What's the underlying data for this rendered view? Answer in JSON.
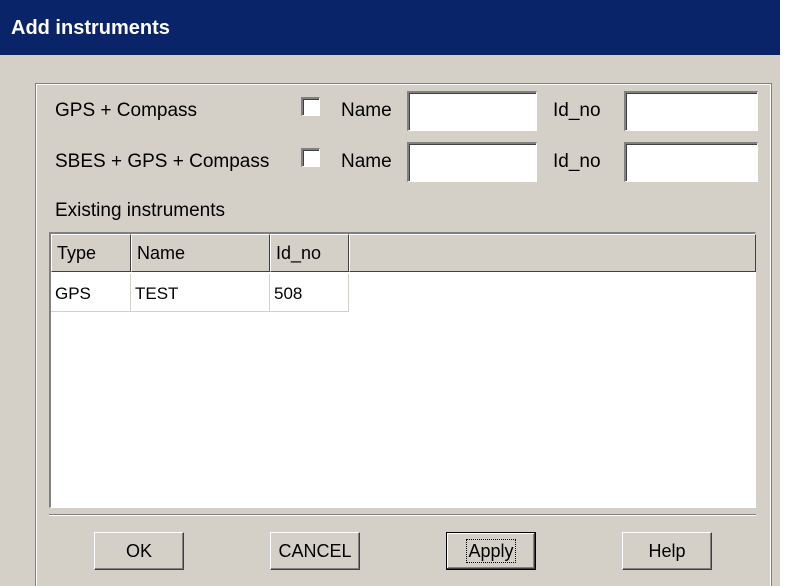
{
  "window": {
    "title": "Add instruments"
  },
  "instruments": [
    {
      "label": "GPS + Compass",
      "checked": false,
      "name_label": "Name",
      "name_value": "",
      "id_label": "Id_no",
      "id_value": ""
    },
    {
      "label": "SBES + GPS + Compass",
      "checked": false,
      "name_label": "Name",
      "name_value": "",
      "id_label": "Id_no",
      "id_value": ""
    }
  ],
  "existing": {
    "label": "Existing instruments",
    "columns": [
      "Type",
      "Name",
      "Id_no"
    ],
    "rows": [
      [
        "GPS",
        "TEST",
        "508"
      ]
    ]
  },
  "buttons": {
    "ok": "OK",
    "cancel": "CANCEL",
    "apply": "Apply",
    "help": "Help"
  },
  "colors": {
    "titlebar": "#0a246a",
    "window_bg": "#d4d0c8"
  }
}
